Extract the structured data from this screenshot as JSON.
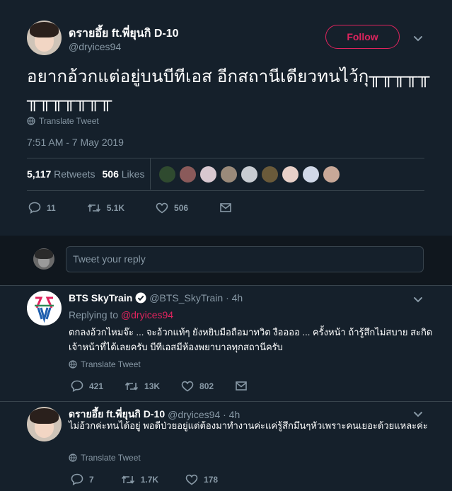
{
  "main_tweet": {
    "author_name": "ดรายอึ้ย ft.พี่ยุนกิ D-10",
    "author_handle": "@dryices94",
    "follow_label": "Follow",
    "text": "อยากอ้วกแต่อยู่บนบีทีเอส อีกสถานีเดียวทนไว้กุ╥╥╥╥╥╥╥╥╥╥╥╥",
    "translate_label": "Translate Tweet",
    "timestamp": "7:51 AM - 7 May 2019",
    "retweets_count": "5,117",
    "retweets_label": "Retweets",
    "likes_count": "506",
    "likes_label": "Likes",
    "liker_colors": [
      "#2f4a2f",
      "#8a5a5a",
      "#d8c8d0",
      "#9a8a7a",
      "#c8ccd2",
      "#6a5a3a",
      "#e8d0c8",
      "#d0d8e8",
      "#c8a898"
    ],
    "actions": {
      "replies": "11",
      "retweets": "5.1K",
      "likes": "506"
    }
  },
  "reply_box": {
    "placeholder": "Tweet your reply"
  },
  "replies": [
    {
      "author_name": "BTS SkyTrain",
      "author_handle": "@BTS_SkyTrain · 4h",
      "replying_prefix": "Replying to",
      "replying_to": "@dryices94",
      "text": "ตกลงอ้วกไหมจ๊ะ ... จะอ้วกแท้ๆ ยังหยิบมือถือมาทวิต งืออออ ... ครั้งหน้า ถ้ารู้สึกไม่สบาย สะกิดเจ้าหน้าที่ได้เลยครับ บีทีเอสมีห้องพยาบาลทุกสถานีครับ",
      "translate_label": "Translate Tweet",
      "actions": {
        "replies": "421",
        "retweets": "13K",
        "likes": "802"
      }
    },
    {
      "author_name": "ดรายอึ้ย ft.พี่ยุนกิ D-10",
      "author_handle": "@dryices94 · 4h",
      "text": "ไม่อ้วกค่ะทนได้อยู่ พอดีป่วยอยู่แต่ต้องมาทำงานค่ะแค่รู้สึกมึนๆหัวเพราะคนเยอะด้วยแหละค่ะ",
      "translate_label": "Translate Tweet",
      "actions": {
        "replies": "7",
        "retweets": "1.7K",
        "likes": "178"
      }
    }
  ]
}
